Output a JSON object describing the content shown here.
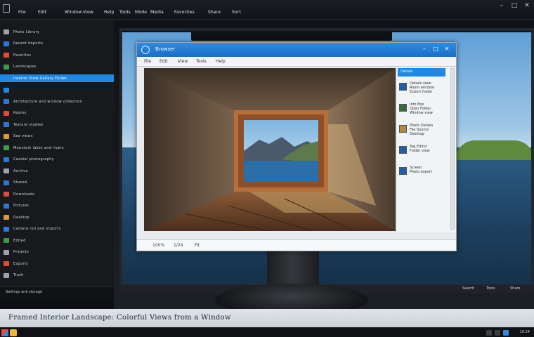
{
  "menubar": {
    "items": [
      "File",
      "Edit",
      "Window",
      "View",
      "Help",
      "Tools",
      "Mode",
      "Media",
      "Favorites",
      "Share",
      "Sort"
    ],
    "window_buttons": [
      "–",
      "□",
      "✕"
    ]
  },
  "left_panel": {
    "items": [
      {
        "label": "Photo Library",
        "color": "#9aa3ad"
      },
      {
        "label": "Recent Imports",
        "color": "#2c78d4"
      },
      {
        "label": "Favorites",
        "color": "#e04a3b"
      },
      {
        "label": "Landscapes",
        "color": "#3c9a4a"
      },
      {
        "label": "Interior View Gallery Folder",
        "color": "#1e88e5",
        "selected": true
      },
      {
        "label": "",
        "color": "#1e88e5"
      },
      {
        "label": "Architecture and window collection",
        "color": "#2c78d4"
      },
      {
        "label": "Rooms",
        "color": "#e04a3b"
      },
      {
        "label": "Texture studies",
        "color": "#2c78d4"
      },
      {
        "label": "Sea views",
        "color": "#d2a03a"
      },
      {
        "label": "Mountain lakes and rivers",
        "color": "#3c9a4a"
      },
      {
        "label": "Coastal photography",
        "color": "#2c78d4"
      },
      {
        "label": "Archive",
        "color": "#9aa3ad"
      },
      {
        "label": "Shared",
        "color": "#2c78d4"
      },
      {
        "label": "Downloads",
        "color": "#e04a3b"
      },
      {
        "label": "Pictures",
        "color": "#2c78d4"
      },
      {
        "label": "Desktop",
        "color": "#d2a03a"
      },
      {
        "label": "Camera roll and imports",
        "color": "#2c78d4"
      },
      {
        "label": "Edited",
        "color": "#3c9a4a"
      },
      {
        "label": "Projects",
        "color": "#9aa3ad"
      },
      {
        "label": "Exports",
        "color": "#e04a3b"
      },
      {
        "label": "Trash",
        "color": "#9aa3ad"
      }
    ],
    "bottom_label": "Settings and storage"
  },
  "viewer": {
    "title": "Browser",
    "toolbar": [
      "File",
      "Edit",
      "View",
      "Tools",
      "Help"
    ],
    "right_pane": {
      "header": "Details",
      "items": [
        {
          "line1": "Details view",
          "line2": "Room window",
          "line3": "Export folder",
          "color": "#1e5fa8"
        },
        {
          "line1": "Info Box",
          "line2": "Open Folder",
          "line3": "Window view",
          "color": "#3a6d3a"
        },
        {
          "line1": "Photo Details",
          "line2": "File Source",
          "line3": "Desktop",
          "color": "#b38a3a"
        },
        {
          "line1": "Tag Editor",
          "line2": "Folder view",
          "line3": "",
          "color": "#1e5fa8"
        },
        {
          "line1": "Screen",
          "line2": "Photo export",
          "line3": "",
          "color": "#1e5fa8"
        }
      ]
    },
    "status": [
      "100%",
      "1/24",
      "Fit"
    ]
  },
  "taskstrip_items": [
    "Search",
    "Tools",
    "Share"
  ],
  "banner_text": "Framed Interior Landscape: Colorful Views from a Window",
  "taskbar": {
    "clock": "10:24"
  }
}
